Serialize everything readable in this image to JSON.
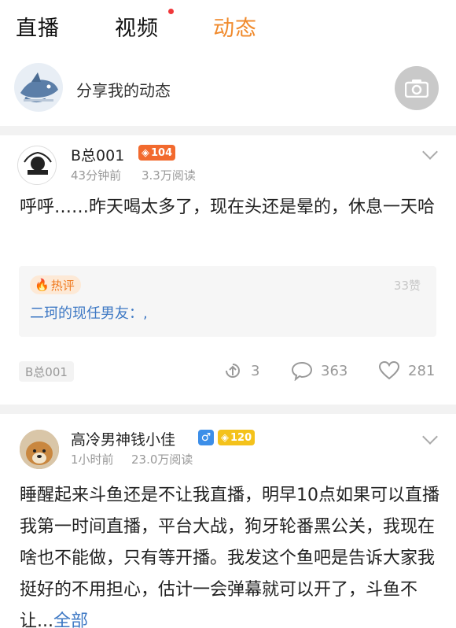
{
  "tabs": [
    {
      "label": "直播"
    },
    {
      "label": "视频"
    },
    {
      "label": "动态"
    }
  ],
  "share": {
    "label": "分享我的动态"
  },
  "post1": {
    "username": "B总001",
    "level": "104",
    "time": "43分钟前",
    "reads": "3.3万阅读",
    "content": "呼呼……昨天喝太多了，现在头还是晕的，休息一天哈",
    "hot_comment": {
      "tag": "热评",
      "likes": "33赞",
      "text": "二珂的现任男友：,"
    },
    "author_tag": "B总001",
    "shares": "3",
    "comments": "363",
    "likes": "281"
  },
  "post2": {
    "username": "高冷男神钱小佳",
    "gender": "♂",
    "level": "120",
    "time": "1小时前",
    "reads": "23.0万阅读",
    "content": "睡醒起来斗鱼还是不让我直播，明早10点如果可以直播我第一时间直播，平台大战，狗牙轮番黑公关，我现在啥也不能做，只有等开播。我发这个鱼吧是告诉大家我挺好的不用担心，估计一会弹幕就可以开了，斗鱼不让...",
    "more": "全部"
  },
  "colors": {
    "accent": "#f08a2c",
    "link": "#3d78c4"
  }
}
